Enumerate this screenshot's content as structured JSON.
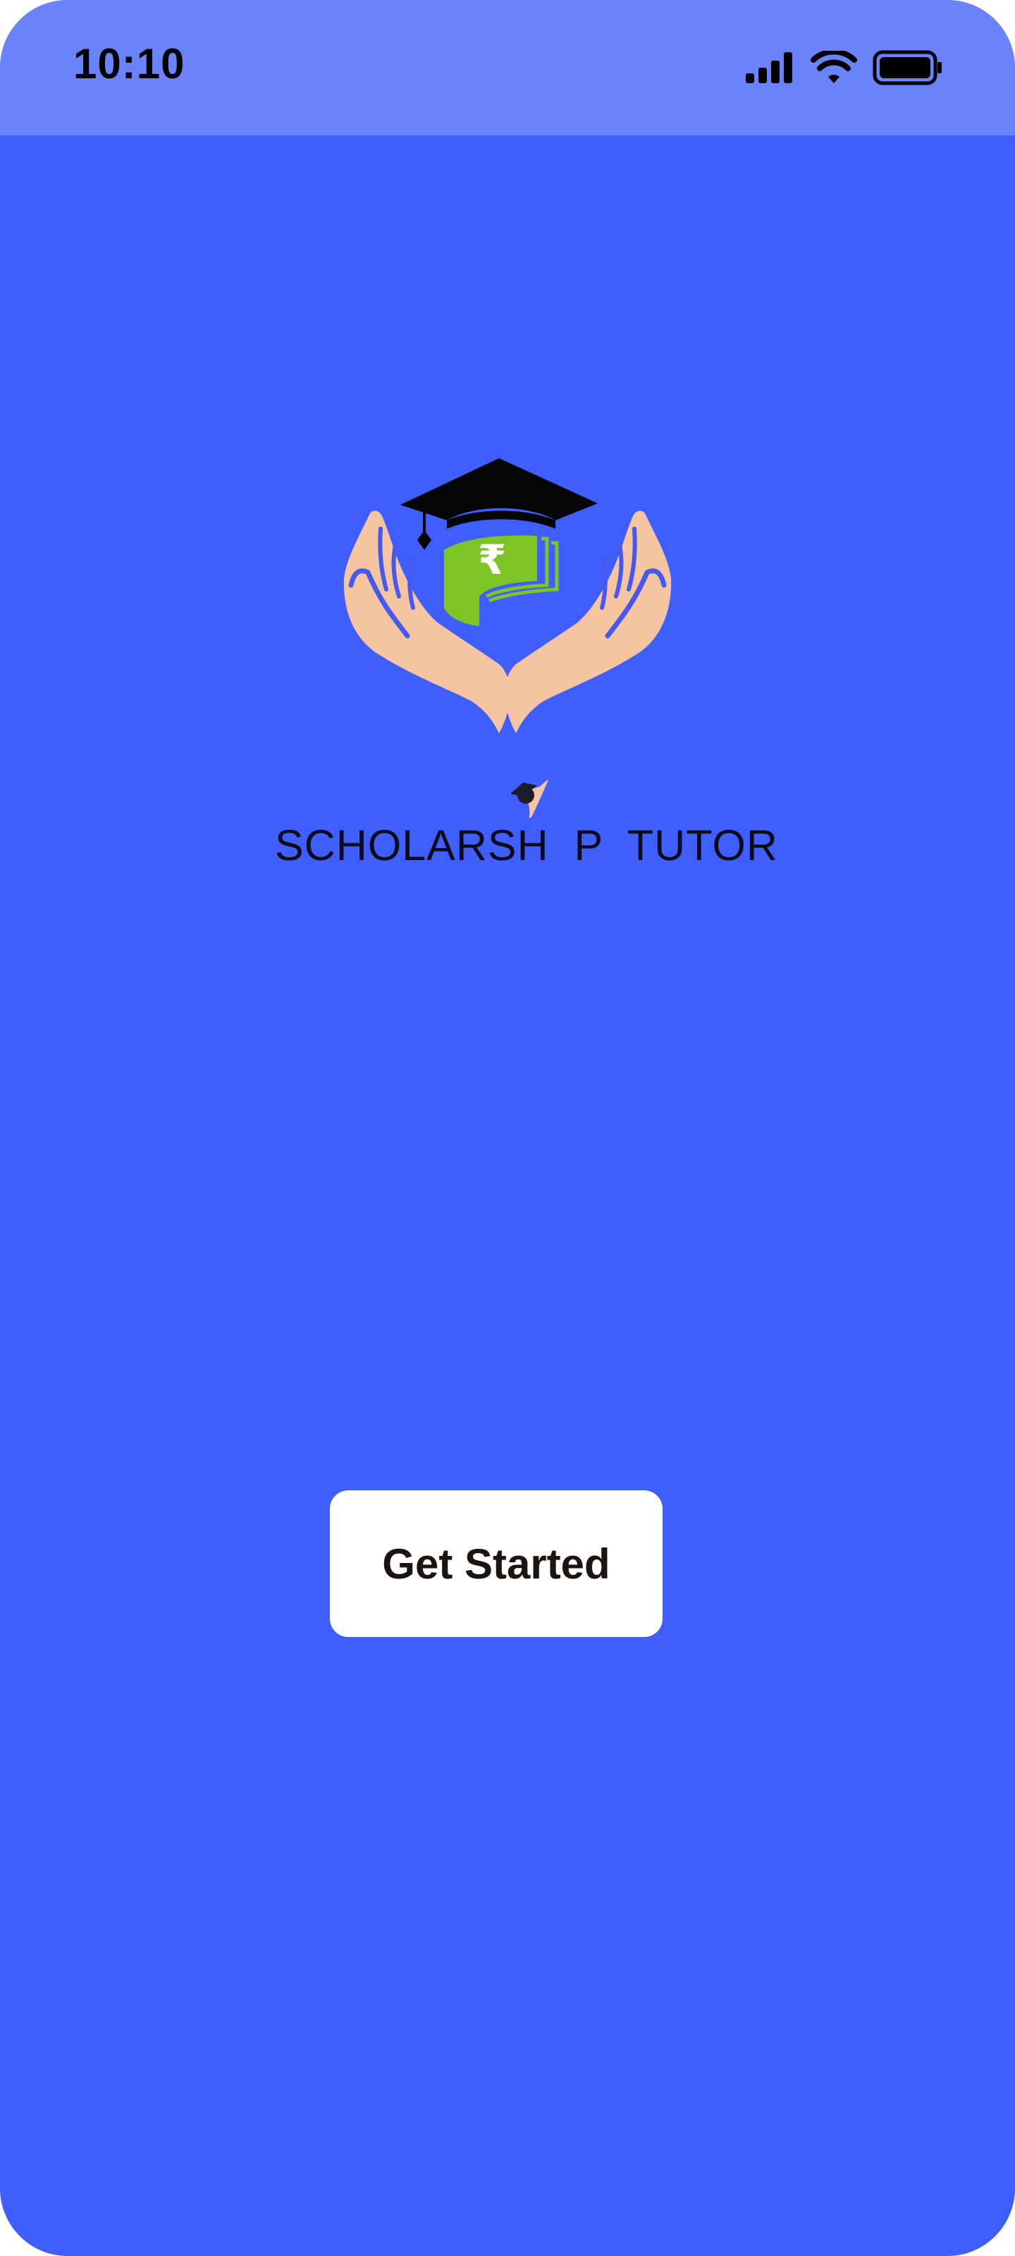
{
  "status_bar": {
    "time": "10:10",
    "icons": [
      "signal-icon",
      "wifi-icon",
      "battery-icon"
    ]
  },
  "logo": {
    "wordmark": "SCHOLARSH  P  TUTOR",
    "currency_symbol": "₹",
    "icons": [
      "graduation-cap-icon",
      "rupee-note-icon",
      "hands-icon",
      "student-figure-icon"
    ]
  },
  "actions": {
    "get_started_label": "Get Started"
  },
  "colors": {
    "background": "#3f5efe",
    "status_bar": "#6a82fa",
    "button_bg": "#ffffff",
    "button_text": "#1c1313",
    "hand_skin": "#f5c4a1",
    "note_green": "#7dc427"
  }
}
